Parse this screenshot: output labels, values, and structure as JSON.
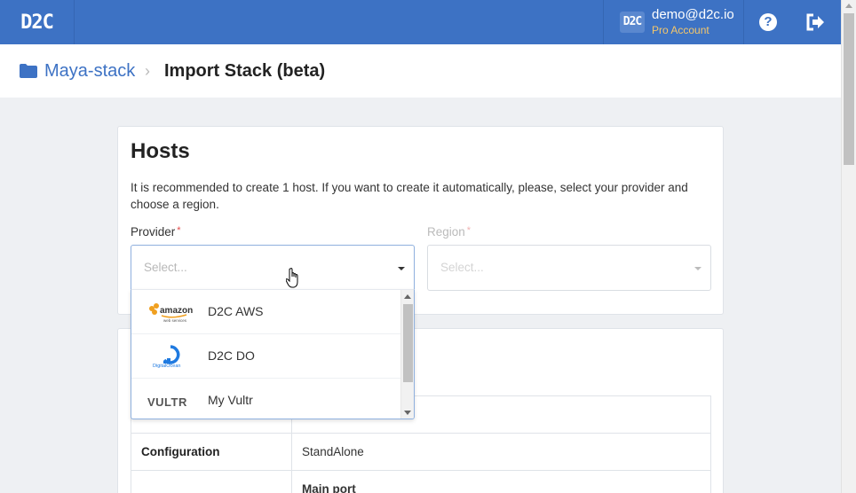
{
  "brand": {
    "logo_text": "D2C",
    "color": "#3d72c4"
  },
  "user": {
    "avatar_text": "D2C",
    "email": "demo@d2c.io",
    "plan": "Pro Account"
  },
  "breadcrumb": {
    "stack": "Maya-stack",
    "separator": "›",
    "current": "Import Stack (beta)"
  },
  "hosts": {
    "title": "Hosts",
    "description": "It is recommended to create 1 host. If you want to create it automatically, please, select your provider and choose a region.",
    "provider_label": "Provider",
    "region_label": "Region",
    "required_mark": "*",
    "provider_placeholder": "Select...",
    "region_placeholder": "Select..."
  },
  "provider_options": [
    {
      "label": "D2C AWS",
      "icon": "amazon-web-services-logo"
    },
    {
      "label": "D2C DO",
      "icon": "digitalocean-logo"
    },
    {
      "label": "My Vultr",
      "icon": "vultr-logo"
    }
  ],
  "details_table": {
    "rows": [
      {
        "key": "Configuration",
        "value": "StandAlone"
      },
      {
        "key": "",
        "value": "Main port"
      }
    ]
  }
}
